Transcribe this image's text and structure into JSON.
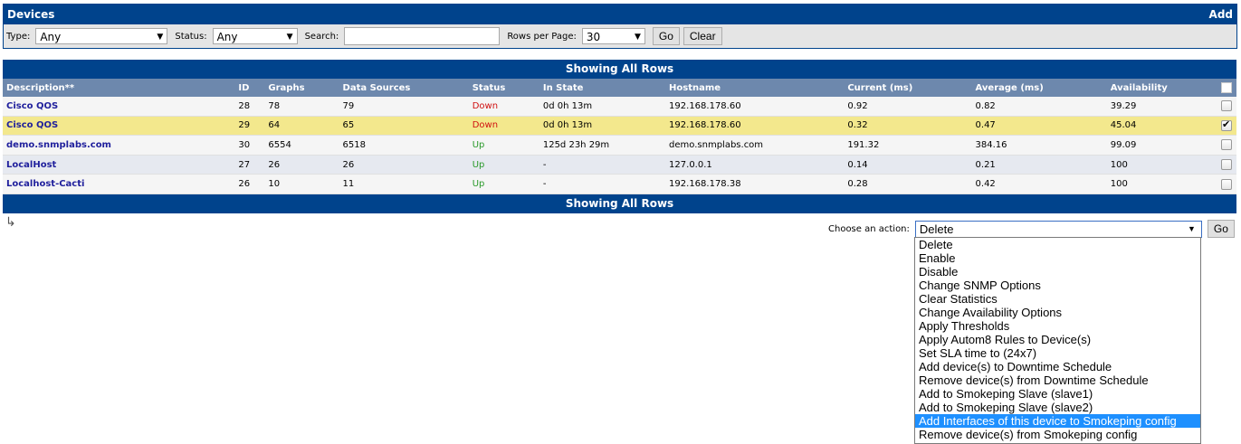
{
  "header": {
    "title": "Devices",
    "add_label": "Add"
  },
  "filters": {
    "type_label": "Type:",
    "type_value": "Any",
    "status_label": "Status:",
    "status_value": "Any",
    "search_label": "Search:",
    "search_value": "",
    "rows_label": "Rows per Page:",
    "rows_value": "30",
    "go_label": "Go",
    "clear_label": "Clear"
  },
  "table": {
    "top_bar": "Showing All Rows",
    "bottom_bar": "Showing All Rows",
    "columns": [
      "Description**",
      "ID",
      "Graphs",
      "Data Sources",
      "Status",
      "In State",
      "Hostname",
      "Current (ms)",
      "Average (ms)",
      "Availability"
    ],
    "rows": [
      {
        "description": "Cisco QOS",
        "id": "28",
        "graphs": "78",
        "data_sources": "79",
        "status": "Down",
        "in_state": "0d 0h 13m",
        "hostname": "192.168.178.60",
        "current": "0.92",
        "average": "0.82",
        "availability": "39.29",
        "checked": false
      },
      {
        "description": "Cisco QOS",
        "id": "29",
        "graphs": "64",
        "data_sources": "65",
        "status": "Down",
        "in_state": "0d 0h 13m",
        "hostname": "192.168.178.60",
        "current": "0.32",
        "average": "0.47",
        "availability": "45.04",
        "checked": true
      },
      {
        "description": "demo.snmplabs.com",
        "id": "30",
        "graphs": "6554",
        "data_sources": "6518",
        "status": "Up",
        "in_state": "125d 23h 29m",
        "hostname": "demo.snmplabs.com",
        "current": "191.32",
        "average": "384.16",
        "availability": "99.09",
        "checked": false
      },
      {
        "description": "LocalHost",
        "id": "27",
        "graphs": "26",
        "data_sources": "26",
        "status": "Up",
        "in_state": "-",
        "hostname": "127.0.0.1",
        "current": "0.14",
        "average": "0.21",
        "availability": "100",
        "checked": false
      },
      {
        "description": "Localhost-Cacti",
        "id": "26",
        "graphs": "10",
        "data_sources": "11",
        "status": "Up",
        "in_state": "-",
        "hostname": "192.168.178.38",
        "current": "0.28",
        "average": "0.42",
        "availability": "100",
        "checked": false
      }
    ]
  },
  "actions": {
    "label": "Choose an action:",
    "selected": "Delete",
    "go_label": "Go",
    "highlighted_index": 12,
    "options": [
      "Delete",
      "Enable",
      "Disable",
      "Change SNMP Options",
      "Clear Statistics",
      "Change Availability Options",
      "Apply Thresholds",
      "Apply Autom8 Rules to Device(s)",
      "Set SLA time to (24x7)",
      "Add device(s) to Downtime Schedule",
      "Remove device(s) from Downtime Schedule",
      "Add to Smokeping Slave (slave1)",
      "Add to Smokeping Slave (slave2)",
      "Add Interfaces of this device to Smokeping config",
      "Remove device(s) from Smokeping config"
    ]
  },
  "icons": {
    "return_arrow": "return-arrow-icon",
    "dropdown_arrow": "chevron-down-icon"
  },
  "colors": {
    "header_blue": "#00438c",
    "column_header": "#6d88ad",
    "selected_row": "#f3e88d",
    "status_down": "#d01010",
    "status_up": "#2b9a2b",
    "link": "#1f1f9c",
    "highlight": "#1e90ff"
  }
}
